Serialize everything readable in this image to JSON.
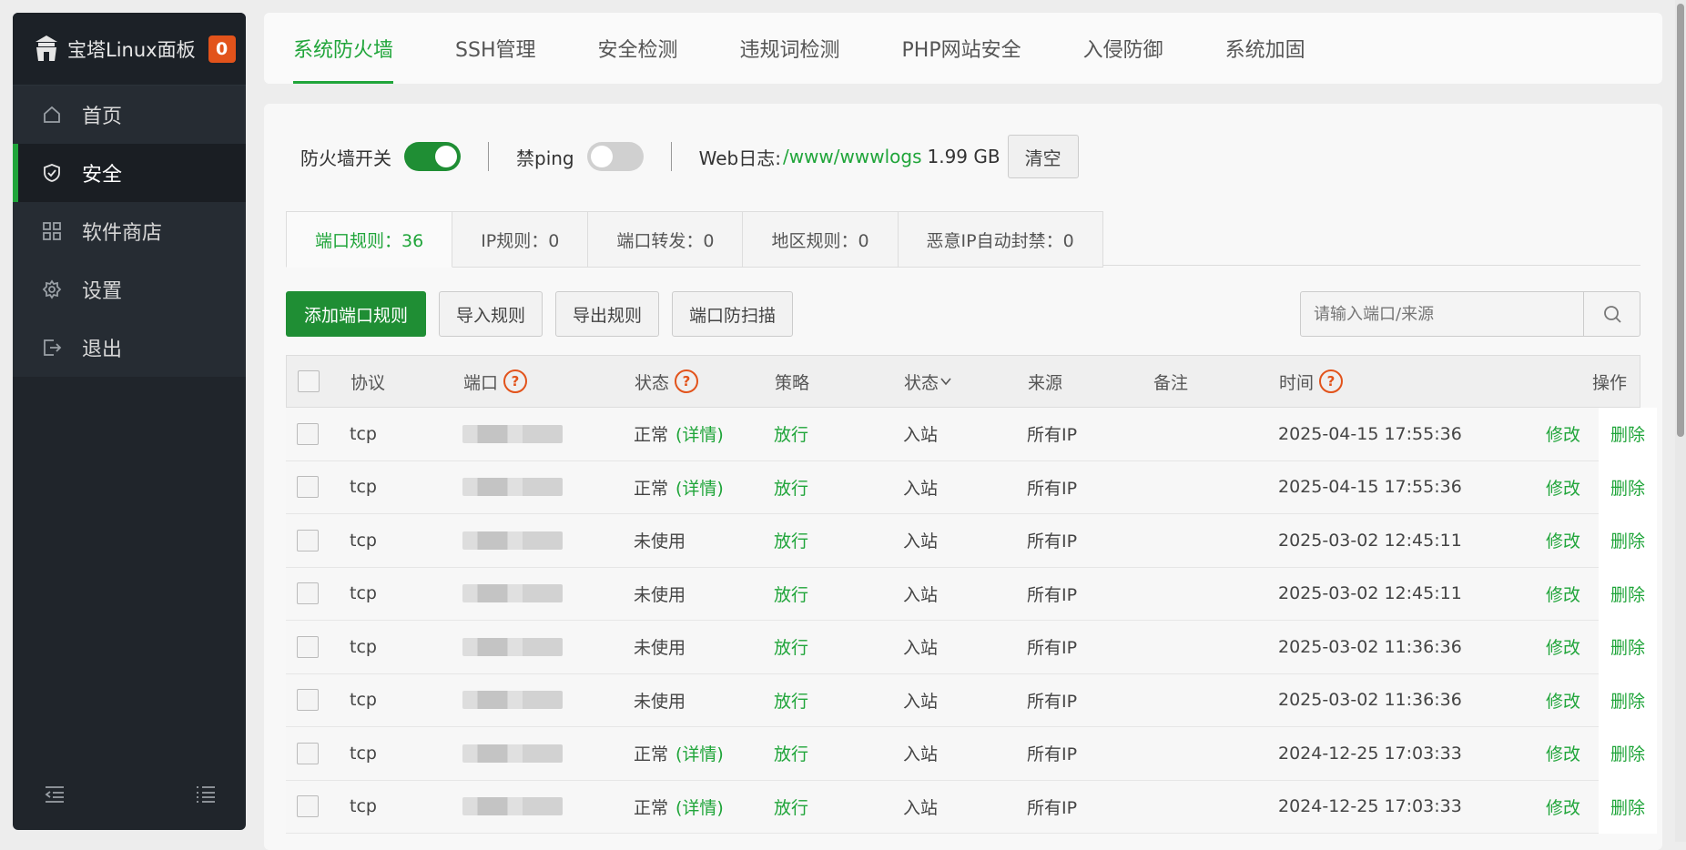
{
  "sidebar": {
    "brand": "宝塔Linux面板",
    "badge": "0",
    "items": [
      {
        "label": "首页",
        "icon": "home-icon"
      },
      {
        "label": "安全",
        "icon": "shield-icon",
        "active": true
      },
      {
        "label": "软件商店",
        "icon": "apps-icon"
      },
      {
        "label": "设置",
        "icon": "gear-icon"
      },
      {
        "label": "退出",
        "icon": "logout-icon"
      }
    ]
  },
  "tabs": [
    "系统防火墙",
    "SSH管理",
    "安全检测",
    "违规词检测",
    "PHP网站安全",
    "入侵防御",
    "系统加固"
  ],
  "switches": {
    "firewall_label": "防火墙开关",
    "firewall_on": true,
    "ping_label": "禁ping",
    "ping_on": false,
    "weblog_label": "Web日志:",
    "weblog_path": "/www/wwwlogs",
    "weblog_size": "1.99 GB",
    "clear_label": "清空"
  },
  "subtabs": [
    "端口规则：36",
    "IP规则：0",
    "端口转发：0",
    "地区规则：0",
    "恶意IP自动封禁：0"
  ],
  "actions": {
    "add": "添加端口规则",
    "import": "导入规则",
    "export": "导出规则",
    "scan": "端口防扫描"
  },
  "search": {
    "placeholder": "请输入端口/来源"
  },
  "table": {
    "headers": {
      "protocol": "协议",
      "port": "端口",
      "status": "状态",
      "policy": "策略",
      "direction": "状态",
      "source": "来源",
      "note": "备注",
      "time": "时间",
      "op": "操作"
    },
    "help_mark": "?",
    "detail_label": "(详情)",
    "edit_label": "修改",
    "delete_label": "删除",
    "rows": [
      {
        "protocol": "tcp",
        "status": "正常",
        "detail": true,
        "policy": "放行",
        "direction": "入站",
        "source": "所有IP",
        "time": "2025-04-15 17:55:36"
      },
      {
        "protocol": "tcp",
        "status": "正常",
        "detail": true,
        "policy": "放行",
        "direction": "入站",
        "source": "所有IP",
        "time": "2025-04-15 17:55:36"
      },
      {
        "protocol": "tcp",
        "status": "未使用",
        "detail": false,
        "policy": "放行",
        "direction": "入站",
        "source": "所有IP",
        "time": "2025-03-02 12:45:11"
      },
      {
        "protocol": "tcp",
        "status": "未使用",
        "detail": false,
        "policy": "放行",
        "direction": "入站",
        "source": "所有IP",
        "time": "2025-03-02 12:45:11"
      },
      {
        "protocol": "tcp",
        "status": "未使用",
        "detail": false,
        "policy": "放行",
        "direction": "入站",
        "source": "所有IP",
        "time": "2025-03-02 11:36:36"
      },
      {
        "protocol": "tcp",
        "status": "未使用",
        "detail": false,
        "policy": "放行",
        "direction": "入站",
        "source": "所有IP",
        "time": "2025-03-02 11:36:36"
      },
      {
        "protocol": "tcp",
        "status": "正常",
        "detail": true,
        "policy": "放行",
        "direction": "入站",
        "source": "所有IP",
        "time": "2024-12-25 17:03:33"
      },
      {
        "protocol": "tcp",
        "status": "正常",
        "detail": true,
        "policy": "放行",
        "direction": "入站",
        "source": "所有IP",
        "time": "2024-12-25 17:03:33"
      }
    ]
  },
  "colors": {
    "accent": "#20a53a",
    "sidebar": "#20252b",
    "badge": "#e2531b"
  }
}
